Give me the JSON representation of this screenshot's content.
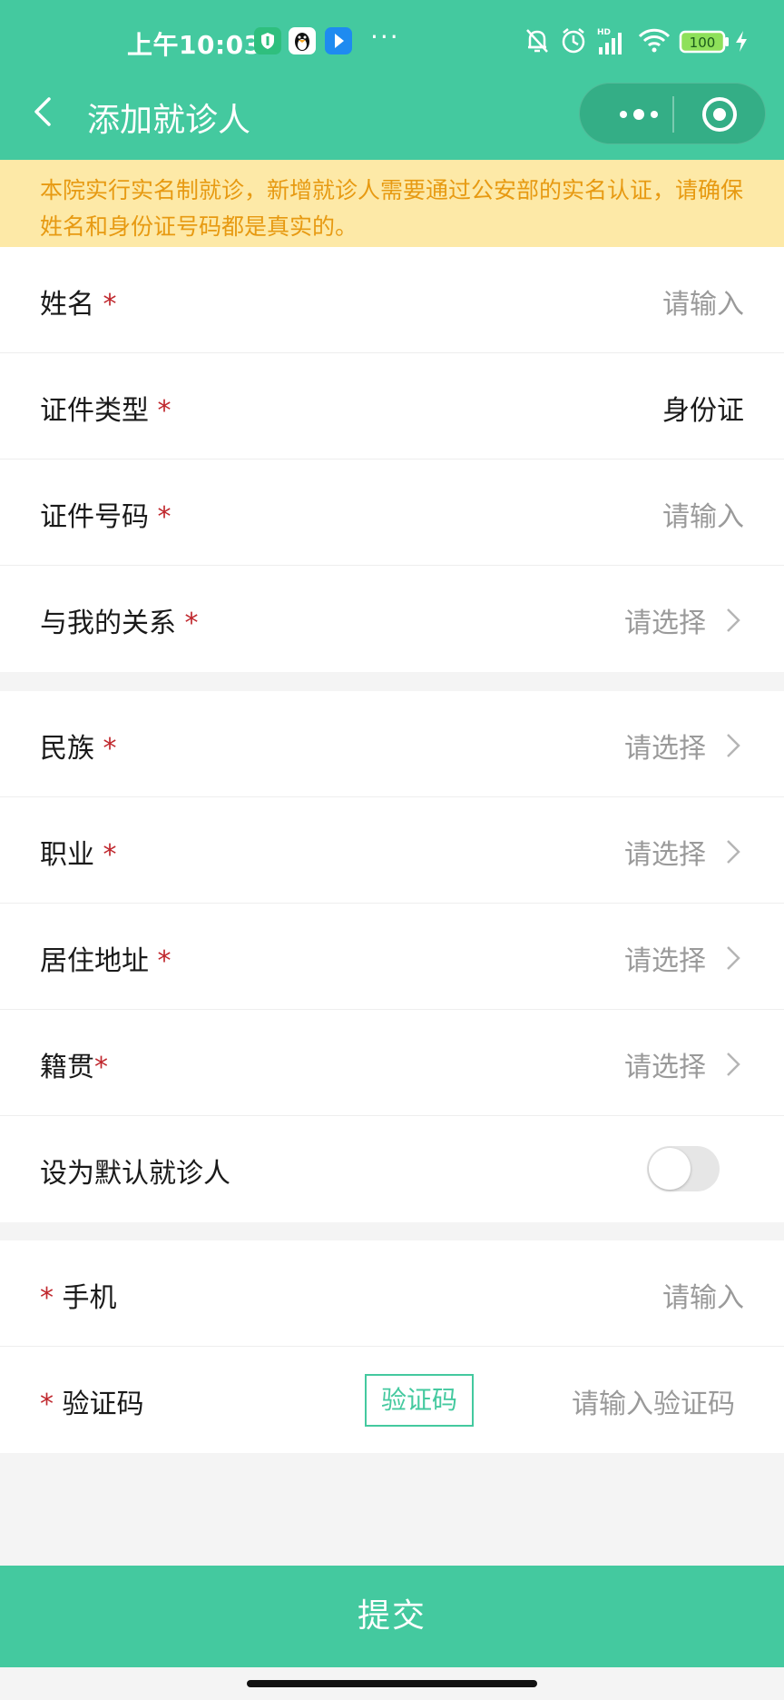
{
  "status_bar": {
    "time": "上午10:03",
    "dots": "···",
    "battery": "100",
    "icons": [
      "shield-app-icon",
      "penguin-app-icon",
      "arrow-app-icon",
      "bell-off-icon",
      "alarm-icon",
      "signal-icon",
      "wifi-icon",
      "battery-icon",
      "charging-icon"
    ]
  },
  "nav": {
    "title": "添加就诊人",
    "icons": [
      "back-arrow-icon",
      "more-dots-icon",
      "close-target-icon"
    ]
  },
  "notice": {
    "text": "本院实行实名制就诊，新增就诊人需要通过公安部的实名认证，请确保姓名和身份证号码都是真实的。"
  },
  "form": {
    "required_mark": "*",
    "group1": [
      {
        "label": "姓名 ",
        "value": "请输入"
      },
      {
        "label": "证件类型 ",
        "value": "身份证"
      },
      {
        "label": "证件号码 ",
        "value": "请输入"
      },
      {
        "label": "与我的关系 ",
        "value": "请选择"
      }
    ],
    "group2": [
      {
        "label": "民族 ",
        "value": "请选择"
      },
      {
        "label": "职业 ",
        "value": "请选择"
      },
      {
        "label": "居住地址 ",
        "value": "请选择"
      },
      {
        "label": "籍贯",
        "value": "请选择"
      },
      {
        "label": "设为默认就诊人",
        "toggle_on": false
      }
    ],
    "group3": [
      {
        "label": " 手机",
        "value": "请输入"
      },
      {
        "label": " 验证码",
        "button": "验证码",
        "placeholder": "请输入验证码"
      }
    ]
  },
  "submit_label": "提交",
  "colors": {
    "primary": "#44c99f",
    "notice_bg": "#fde9a7",
    "notice_text": "#e79a12",
    "required": "#c0282e"
  }
}
